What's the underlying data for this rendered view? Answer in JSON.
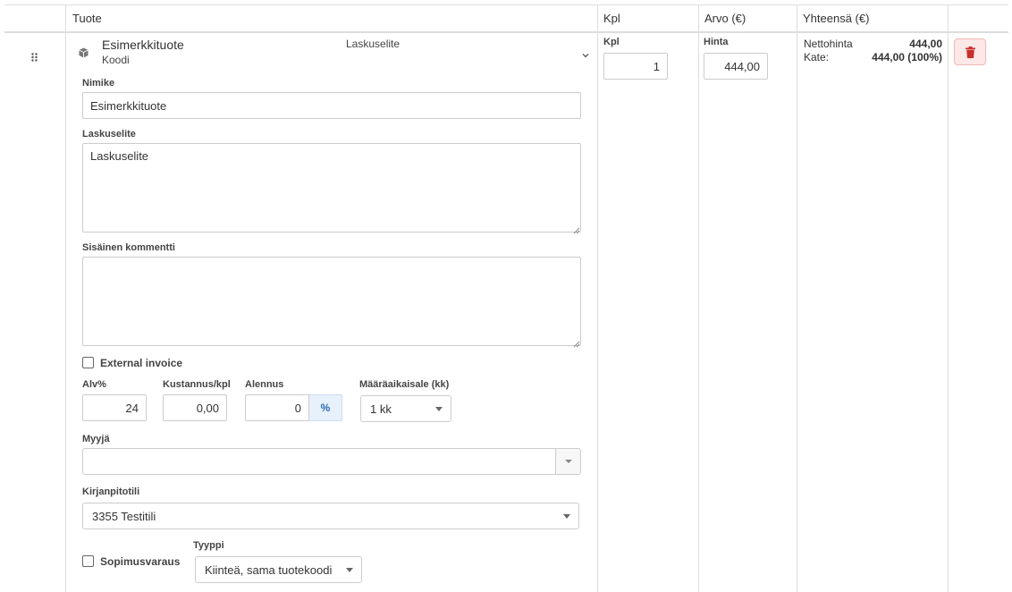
{
  "headers": {
    "product": "Tuote",
    "qty": "Kpl",
    "value": "Arvo (€)",
    "total": "Yhteensä (€)"
  },
  "row": {
    "product_name": "Esimerkkituote",
    "product_code": "Koodi",
    "invoice_desc_preview": "Laskuselite",
    "qty_label": "Kpl",
    "qty_value": "1",
    "price_label": "Hinta",
    "price_value": "444,00",
    "net_label": "Nettohinta",
    "net_value": "444,00",
    "margin_label": "Kate:",
    "margin_value": "444,00 (100%)"
  },
  "form": {
    "name_label": "Nimike",
    "name_value": "Esimerkkituote",
    "invoice_desc_label": "Laskuselite",
    "invoice_desc_value": "Laskuselite",
    "internal_comment_label": "Sisäinen kommentti",
    "internal_comment_value": "",
    "external_invoice_label": "External invoice",
    "vat_label": "Alv%",
    "vat_value": "24",
    "cost_label": "Kustannus/kpl",
    "cost_value": "0,00",
    "discount_label": "Alennus",
    "discount_value": "0",
    "discount_unit": "%",
    "fixed_term_label": "Määräaikaisale (kk)",
    "fixed_term_value": "1 kk",
    "seller_label": "Myyjä",
    "seller_value": "",
    "account_label": "Kirjanpitotili",
    "account_value": "3355 Testitili",
    "contract_label": "Sopimusvaraus",
    "type_label": "Tyyppi",
    "type_value": "Kiinteä, sama tuotekoodi"
  },
  "icons": {
    "drag": "drag-handle-icon",
    "product": "box-icon",
    "expand": "chevron-down-icon",
    "delete": "trash-icon"
  },
  "colors": {
    "delete": "#c9302c",
    "addon": "#2a6eb5"
  }
}
